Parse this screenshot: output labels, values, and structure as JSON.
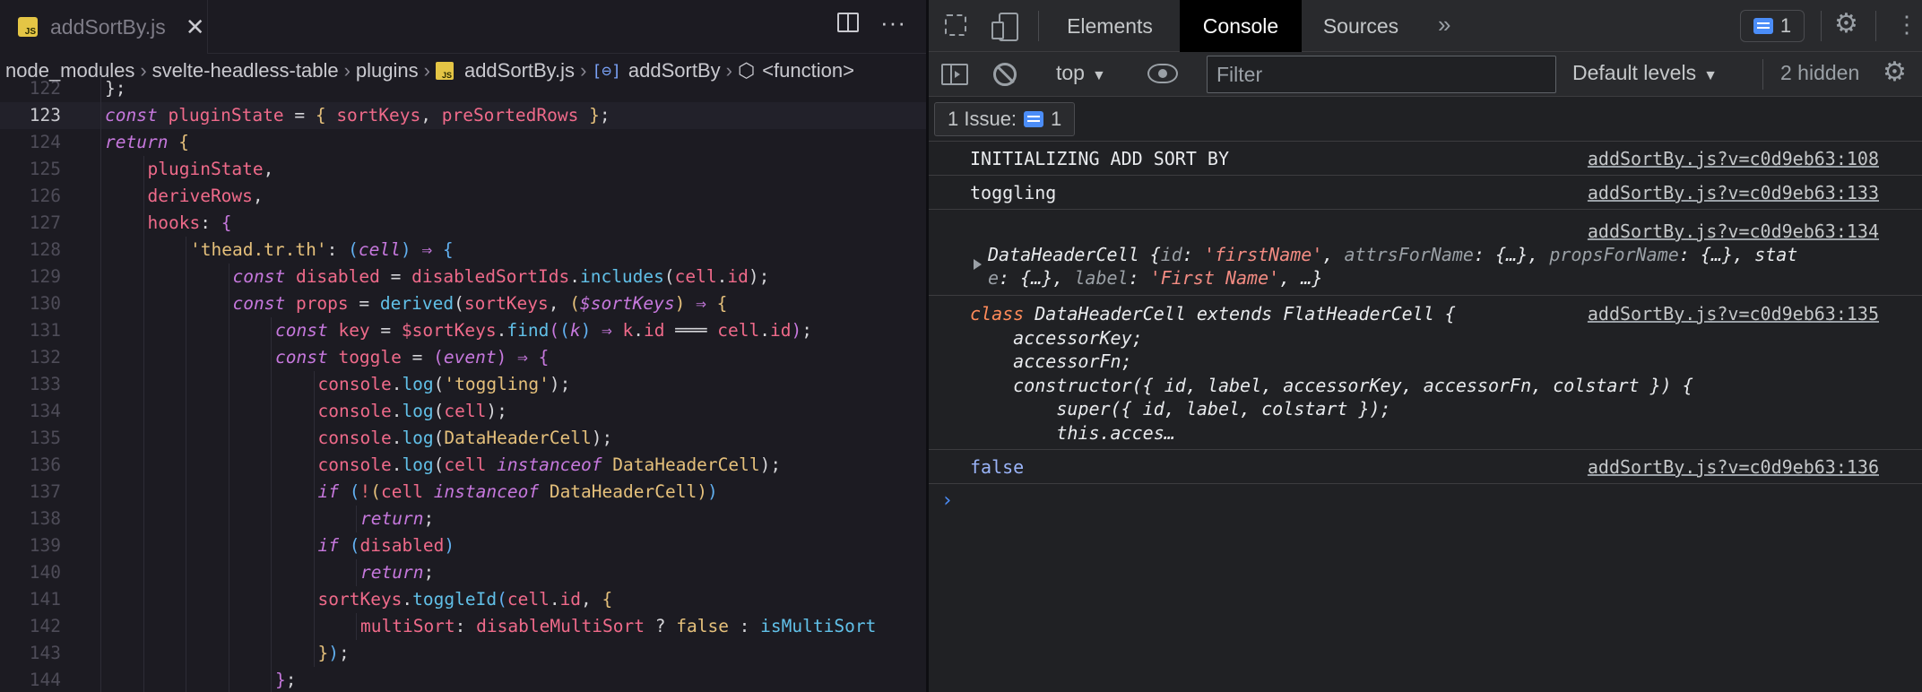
{
  "editor": {
    "tab": {
      "label": "addSortBy.js",
      "badge": "JS"
    },
    "breadcrumb": [
      "node_modules",
      "svelte-headless-table",
      "plugins",
      "addSortBy.js",
      "addSortBy",
      "<function>"
    ],
    "lines": [
      {
        "n": "122",
        "parts": [
          [
            "p",
            "};"
          ]
        ],
        "indent": 1
      },
      {
        "n": "123",
        "active": true,
        "indent": 1,
        "parts": [
          [
            "k",
            "const "
          ],
          [
            "v",
            "pluginState"
          ],
          [
            "p",
            " = "
          ],
          [
            "br",
            "{ "
          ],
          [
            "v",
            "sortKeys"
          ],
          [
            "p",
            ", "
          ],
          [
            "v",
            "preSortedRows"
          ],
          [
            "br",
            " }"
          ],
          [
            "p",
            ";"
          ]
        ]
      },
      {
        "n": "124",
        "indent": 1,
        "parts": [
          [
            "k",
            "return "
          ],
          [
            "br",
            "{"
          ]
        ]
      },
      {
        "n": "125",
        "indent": 2,
        "parts": [
          [
            "v",
            "pluginState"
          ],
          [
            "p",
            ","
          ]
        ]
      },
      {
        "n": "126",
        "indent": 2,
        "parts": [
          [
            "v",
            "deriveRows"
          ],
          [
            "p",
            ","
          ]
        ]
      },
      {
        "n": "127",
        "indent": 2,
        "parts": [
          [
            "v",
            "hooks"
          ],
          [
            "p",
            ": "
          ],
          [
            "br2",
            "{"
          ]
        ]
      },
      {
        "n": "128",
        "indent": 3,
        "parts": [
          [
            "s",
            "'thead.tr.th'"
          ],
          [
            "p",
            ": "
          ],
          [
            "br3",
            "("
          ],
          [
            "pa",
            "cell"
          ],
          [
            "br3",
            ")"
          ],
          [
            "op",
            " ⇒ "
          ],
          [
            "br3",
            "{"
          ]
        ]
      },
      {
        "n": "129",
        "indent": 4,
        "parts": [
          [
            "k",
            "const "
          ],
          [
            "v",
            "disabled"
          ],
          [
            "p",
            " = "
          ],
          [
            "v",
            "disabledSortIds"
          ],
          [
            "p",
            "."
          ],
          [
            "f",
            "includes"
          ],
          [
            "p",
            "("
          ],
          [
            "v",
            "cell"
          ],
          [
            "p",
            "."
          ],
          [
            "v",
            "id"
          ],
          [
            "p",
            ");"
          ]
        ]
      },
      {
        "n": "130",
        "indent": 4,
        "parts": [
          [
            "k",
            "const "
          ],
          [
            "v",
            "props"
          ],
          [
            "p",
            " = "
          ],
          [
            "f",
            "derived"
          ],
          [
            "p",
            "("
          ],
          [
            "v",
            "sortKeys"
          ],
          [
            "p",
            ", "
          ],
          [
            "br",
            "("
          ],
          [
            "pa",
            "$sortKeys"
          ],
          [
            "br",
            ")"
          ],
          [
            "op",
            " ⇒ "
          ],
          [
            "br",
            "{"
          ]
        ]
      },
      {
        "n": "131",
        "indent": 5,
        "parts": [
          [
            "k",
            "const "
          ],
          [
            "v",
            "key"
          ],
          [
            "p",
            " = "
          ],
          [
            "v",
            "$sortKeys"
          ],
          [
            "p",
            "."
          ],
          [
            "f",
            "find"
          ],
          [
            "br2",
            "("
          ],
          [
            "br3",
            "("
          ],
          [
            "pa",
            "k"
          ],
          [
            "br3",
            ")"
          ],
          [
            "op",
            " ⇒ "
          ],
          [
            "v",
            "k"
          ],
          [
            "p",
            "."
          ],
          [
            "v",
            "id"
          ],
          [
            "p",
            " ═══ "
          ],
          [
            "v",
            "cell"
          ],
          [
            "p",
            "."
          ],
          [
            "v",
            "id"
          ],
          [
            "br2",
            ")"
          ],
          [
            "p",
            ";"
          ]
        ]
      },
      {
        "n": "132",
        "indent": 5,
        "parts": [
          [
            "k",
            "const "
          ],
          [
            "v",
            "toggle"
          ],
          [
            "p",
            " = "
          ],
          [
            "br2",
            "("
          ],
          [
            "pa",
            "event"
          ],
          [
            "br2",
            ")"
          ],
          [
            "op",
            " ⇒ "
          ],
          [
            "br2",
            "{"
          ]
        ]
      },
      {
        "n": "133",
        "indent": 6,
        "parts": [
          [
            "v",
            "console"
          ],
          [
            "p",
            "."
          ],
          [
            "f",
            "log"
          ],
          [
            "p",
            "("
          ],
          [
            "s",
            "'toggling'"
          ],
          [
            "p",
            ");"
          ]
        ]
      },
      {
        "n": "134",
        "indent": 6,
        "parts": [
          [
            "v",
            "console"
          ],
          [
            "p",
            "."
          ],
          [
            "f",
            "log"
          ],
          [
            "p",
            "("
          ],
          [
            "v",
            "cell"
          ],
          [
            "p",
            ");"
          ]
        ]
      },
      {
        "n": "135",
        "indent": 6,
        "parts": [
          [
            "v",
            "console"
          ],
          [
            "p",
            "."
          ],
          [
            "f",
            "log"
          ],
          [
            "p",
            "("
          ],
          [
            "s",
            "DataHeaderCell"
          ],
          [
            "p",
            ");"
          ]
        ]
      },
      {
        "n": "136",
        "indent": 6,
        "parts": [
          [
            "v",
            "console"
          ],
          [
            "p",
            "."
          ],
          [
            "f",
            "log"
          ],
          [
            "p",
            "("
          ],
          [
            "v",
            "cell "
          ],
          [
            "pa",
            "instanceof "
          ],
          [
            "s",
            "DataHeaderCell"
          ],
          [
            "p",
            ");"
          ]
        ]
      },
      {
        "n": "137",
        "indent": 6,
        "parts": [
          [
            "k",
            "if "
          ],
          [
            "br3",
            "("
          ],
          [
            "kw2",
            "!"
          ],
          [
            "br",
            "("
          ],
          [
            "v",
            "cell "
          ],
          [
            "pa",
            "instanceof "
          ],
          [
            "s",
            "DataHeaderCell"
          ],
          [
            "br",
            ")"
          ],
          [
            "br3",
            ")"
          ]
        ]
      },
      {
        "n": "138",
        "indent": 7,
        "parts": [
          [
            "k",
            "return"
          ],
          [
            "p",
            ";"
          ]
        ]
      },
      {
        "n": "139",
        "indent": 6,
        "parts": [
          [
            "k",
            "if "
          ],
          [
            "br3",
            "("
          ],
          [
            "v",
            "disabled"
          ],
          [
            "br3",
            ")"
          ]
        ]
      },
      {
        "n": "140",
        "indent": 7,
        "parts": [
          [
            "k",
            "return"
          ],
          [
            "p",
            ";"
          ]
        ]
      },
      {
        "n": "141",
        "indent": 6,
        "parts": [
          [
            "v",
            "sortKeys"
          ],
          [
            "p",
            "."
          ],
          [
            "f",
            "toggleId"
          ],
          [
            "br3",
            "("
          ],
          [
            "v",
            "cell"
          ],
          [
            "p",
            "."
          ],
          [
            "v",
            "id"
          ],
          [
            "p",
            ", "
          ],
          [
            "br",
            "{"
          ]
        ]
      },
      {
        "n": "142",
        "indent": 7,
        "parts": [
          [
            "v",
            "multiSort"
          ],
          [
            "p",
            ": "
          ],
          [
            "v",
            "disableMultiSort"
          ],
          [
            "p",
            " ? "
          ],
          [
            "s",
            "false"
          ],
          [
            "p",
            " : "
          ],
          [
            "f",
            "isMultiSort"
          ]
        ]
      },
      {
        "n": "143",
        "indent": 6,
        "parts": [
          [
            "br",
            "}"
          ],
          [
            "br3",
            ")"
          ],
          [
            "p",
            ";"
          ]
        ]
      },
      {
        "n": "144",
        "indent": 5,
        "parts": [
          [
            "br2",
            "}"
          ],
          [
            "p",
            ";"
          ]
        ]
      }
    ]
  },
  "devtools": {
    "tabs": [
      "Elements",
      "Console",
      "Sources"
    ],
    "active_tab": "Console",
    "issues_badge_count": "1",
    "context": "top",
    "filter_placeholder": "Filter",
    "levels": "Default levels",
    "hidden": "2 hidden",
    "issues_label": "1 Issue:",
    "issues_count": "1",
    "messages": [
      {
        "text": "INITIALIZING ADD SORT BY",
        "source": "addSortBy.js?v=c0d9eb63:108"
      },
      {
        "text": "toggling",
        "source": "addSortBy.js?v=c0d9eb63:133"
      },
      {
        "source": "addSortBy.js?v=c0d9eb63:134",
        "object_line1": "DataHeaderCell {id: 'firstName', attrsForName: {…}, propsForName: {…}, stat",
        "object_line2": "e: {…}, label: 'First Name', …}"
      },
      {
        "source": "addSortBy.js?v=c0d9eb63:135",
        "class_lines": [
          "class DataHeaderCell extends FlatHeaderCell {",
          "    accessorKey;",
          "    accessorFn;",
          "    constructor({ id, label, accessorKey, accessorFn, colstart }) {",
          "        super({ id, label, colstart });",
          "        this.acces…"
        ]
      },
      {
        "text": "false",
        "source": "addSortBy.js?v=c0d9eb63:136"
      }
    ],
    "prompt": "›"
  },
  "colors": {
    "keyword": "#c678dd",
    "variable": "#ef6a8a",
    "function": "#61c0e8",
    "string": "#e5c07b",
    "console_active_tab_bg": "#000000",
    "issue_blue": "#4b8df8"
  }
}
